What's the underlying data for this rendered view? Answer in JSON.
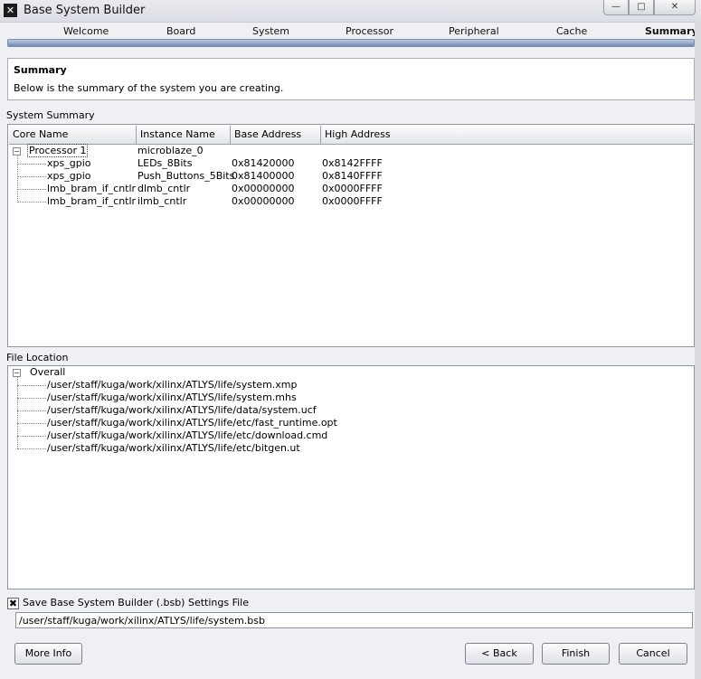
{
  "window": {
    "title": "Base System Builder",
    "minimize_glyph": "—",
    "maximize_glyph": "□",
    "close_glyph": "✕"
  },
  "steps": [
    "Welcome",
    "Board",
    "System",
    "Processor",
    "Peripheral",
    "Cache",
    "Summary"
  ],
  "active_step": "Summary",
  "header": {
    "title": "Summary",
    "description": "Below is the summary of the system you are creating."
  },
  "system_summary": {
    "label": "System Summary",
    "columns": [
      "Core Name",
      "Instance Name",
      "Base Address",
      "High Address"
    ],
    "root": {
      "core": "Processor 1",
      "instance": "microblaze_0"
    },
    "rows": [
      {
        "core": "xps_gpio",
        "instance": "LEDs_8Bits",
        "base": "0x81420000",
        "high": "0x8142FFFF"
      },
      {
        "core": "xps_gpio",
        "instance": "Push_Buttons_5Bits",
        "base": "0x81400000",
        "high": "0x8140FFFF"
      },
      {
        "core": "lmb_bram_if_cntlr",
        "instance": "dlmb_cntlr",
        "base": "0x00000000",
        "high": "0x0000FFFF"
      },
      {
        "core": "lmb_bram_if_cntlr",
        "instance": "ilmb_cntlr",
        "base": "0x00000000",
        "high": "0x0000FFFF"
      }
    ]
  },
  "file_location": {
    "label": "File Location",
    "root": "Overall",
    "files": [
      "/user/staff/kuga/work/xilinx/ATLYS/life/system.xmp",
      "/user/staff/kuga/work/xilinx/ATLYS/life/system.mhs",
      "/user/staff/kuga/work/xilinx/ATLYS/life/data/system.ucf",
      "/user/staff/kuga/work/xilinx/ATLYS/life/etc/fast_runtime.opt",
      "/user/staff/kuga/work/xilinx/ATLYS/life/etc/download.cmd",
      "/user/staff/kuga/work/xilinx/ATLYS/life/etc/bitgen.ut"
    ]
  },
  "save_settings": {
    "checked": true,
    "check_glyph": "✖",
    "label": "Save Base System Builder (.bsb) Settings File",
    "path": "/user/staff/kuga/work/xilinx/ATLYS/life/system.bsb"
  },
  "buttons": {
    "more_info": "More Info",
    "back": "< Back",
    "finish": "Finish",
    "cancel": "Cancel"
  }
}
